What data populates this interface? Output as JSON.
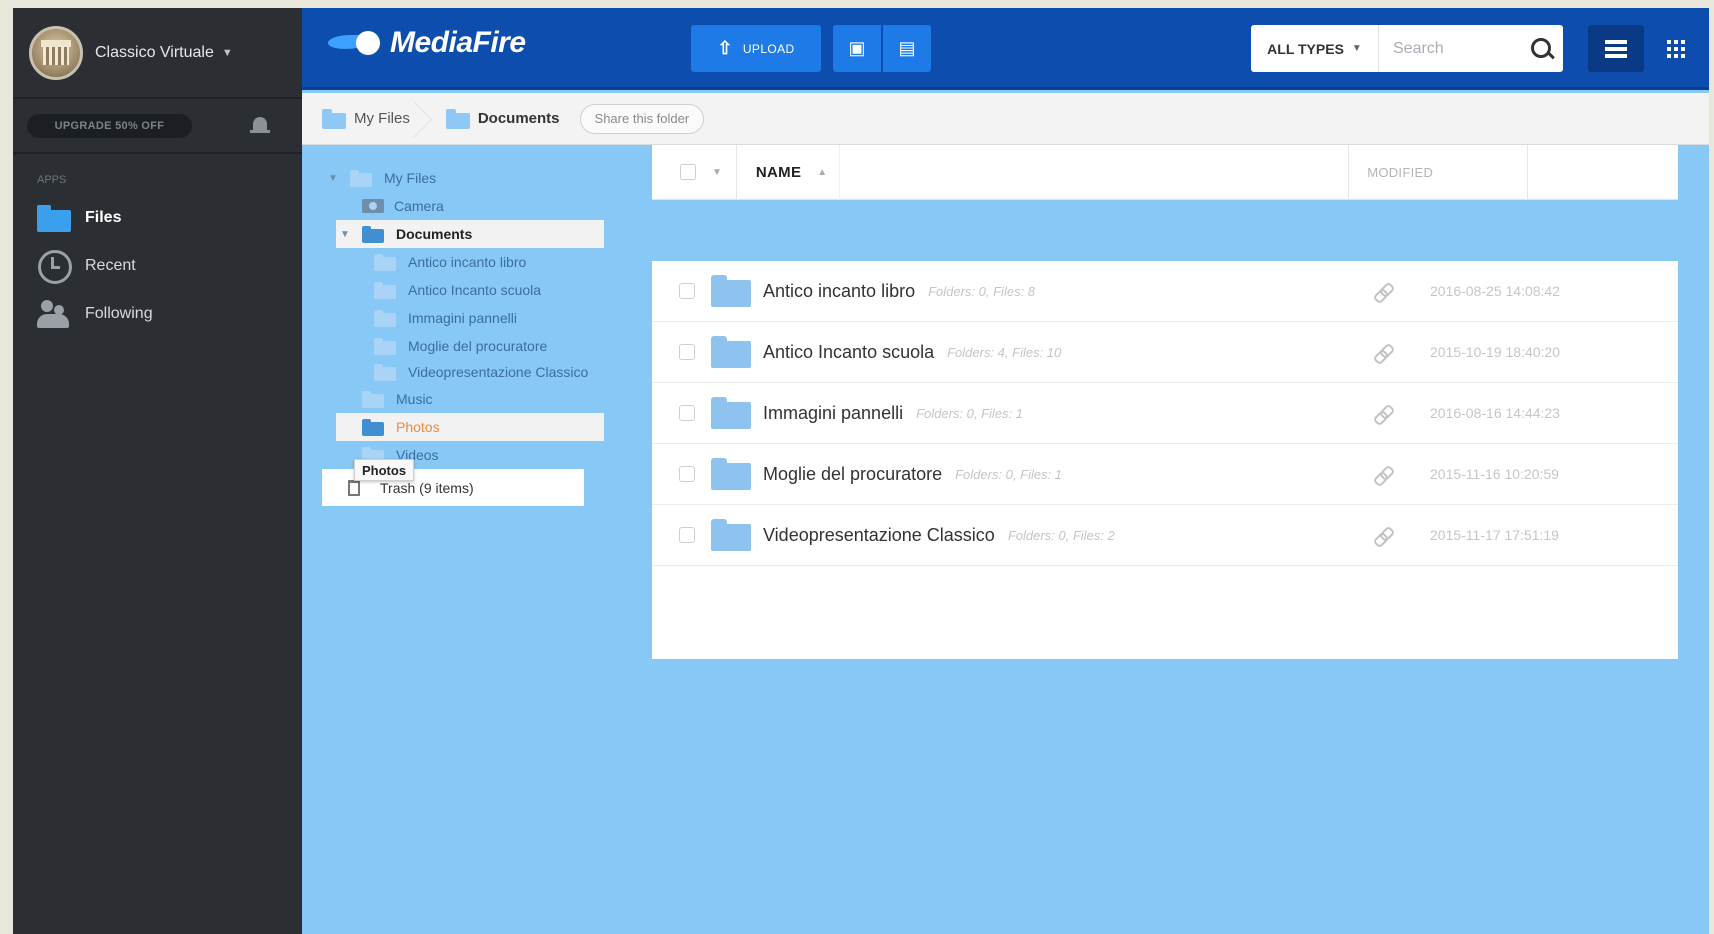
{
  "account": {
    "name": "Classico Virtuale",
    "upgrade_label": "UPGRADE 50% OFF"
  },
  "sidebar": {
    "section_label": "APPS",
    "items": [
      {
        "label": "Files",
        "icon": "folder-icon"
      },
      {
        "label": "Recent",
        "icon": "clock-icon"
      },
      {
        "label": "Following",
        "icon": "people-icon"
      }
    ]
  },
  "header": {
    "logo_text": "MediaFire",
    "upload_label": "UPLOAD",
    "types_label": "ALL TYPES",
    "search_placeholder": "Search"
  },
  "breadcrumb": {
    "items": [
      "My Files",
      "Documents"
    ],
    "share_label": "Share this folder"
  },
  "tree": {
    "root": "My Files",
    "camera": "Camera",
    "documents": "Documents",
    "children": [
      "Antico incanto libro",
      "Antico Incanto scuola",
      "Immagini pannelli",
      "Moglie del procuratore",
      "Videopresentazione Classico"
    ],
    "music": "Music",
    "photos": "Photos",
    "videos": "Videos",
    "trash": "Trash (9 items)",
    "tooltip": "Photos"
  },
  "list": {
    "col_name": "NAME",
    "col_modified": "MODIFIED",
    "rows": [
      {
        "name": "Antico incanto libro",
        "meta": "Folders: 0, Files: 8",
        "modified": "2016-08-25 14:08:42"
      },
      {
        "name": "Antico Incanto scuola",
        "meta": "Folders: 4, Files: 10",
        "modified": "2015-10-19 18:40:20"
      },
      {
        "name": "Immagini pannelli",
        "meta": "Folders: 0, Files: 1",
        "modified": "2016-08-16 14:44:23"
      },
      {
        "name": "Moglie del procuratore",
        "meta": "Folders: 0, Files: 1",
        "modified": "2015-11-16 10:20:59"
      },
      {
        "name": "Videopresentazione Classico",
        "meta": "Folders: 0, Files: 2",
        "modified": "2015-11-17 17:51:19"
      }
    ]
  },
  "colors": {
    "brand_blue": "#0c4dae",
    "button_blue": "#1e7ae6",
    "sidebar": "#2b2f33",
    "canvas": "#88c8f7",
    "accent_orange": "#f08a3c"
  }
}
